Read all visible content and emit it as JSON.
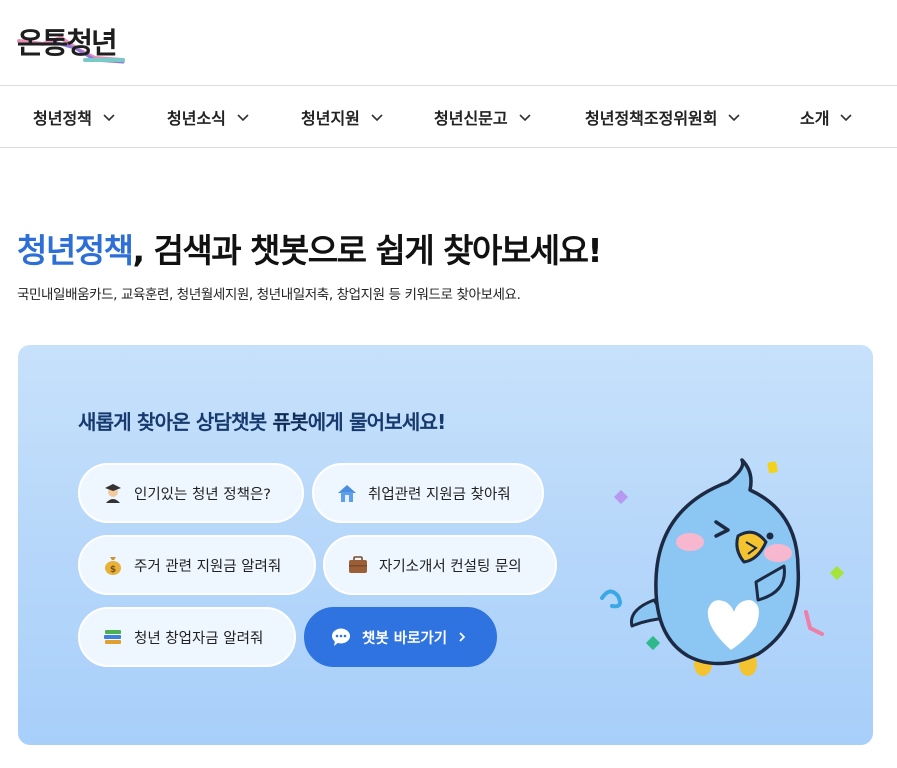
{
  "brand": {
    "logo_text": "온통청년"
  },
  "nav": [
    {
      "label": "청년정책"
    },
    {
      "label": "청년소식"
    },
    {
      "label": "청년지원"
    },
    {
      "label": "청년신문고"
    },
    {
      "label": "청년정책조정위원회"
    },
    {
      "label": "소개"
    }
  ],
  "hero": {
    "title_accent": "청년정책",
    "title_rest": ", 검색과 챗봇으로 쉽게 찾아보세요!",
    "subtitle": "국민내일배움카드, 교육훈련, 청년월세지원, 청년내일저축, 창업지원 등 키워드로 찾아보세요."
  },
  "chatbot": {
    "title_pre": "새롭게 찾아온 상담챗봇 ",
    "title_bot": "퓨봇",
    "title_post": "에게 물어보세요!",
    "suggestions": [
      {
        "label": "인기있는 청년 정책은?",
        "icon": "graduate-icon"
      },
      {
        "label": "취업관련 지원금 찾아줘",
        "icon": "house-icon"
      },
      {
        "label": "주거 관련 지원금 알려줘",
        "icon": "money-bag-icon"
      },
      {
        "label": "자기소개서 컨설팅 문의",
        "icon": "briefcase-icon"
      },
      {
        "label": "청년 창업자금 알려줘",
        "icon": "books-icon"
      }
    ],
    "cta_label": "챗봇 바로가기",
    "cta_icon": "speech-bubble-icon",
    "accent_color": "#2f73e0"
  }
}
